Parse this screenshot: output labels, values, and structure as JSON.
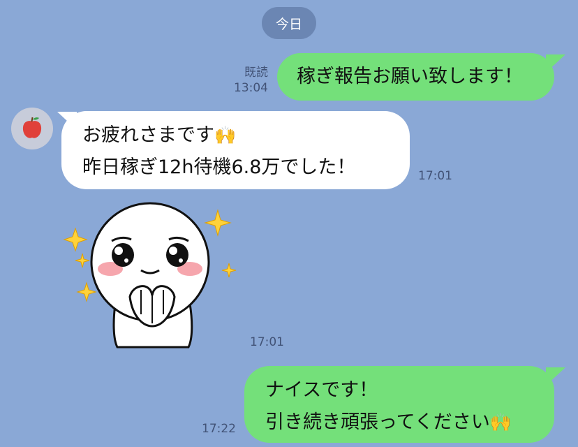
{
  "date_label": "今日",
  "messages": [
    {
      "text": "稼ぎ報告お願い致します！",
      "read_label": "既読",
      "time": "13:04"
    },
    {
      "line1": "お疲れさまです",
      "line1_emoji": "🙌",
      "line2": "昨日稼ぎ12h待機6.8万でした！",
      "time": "17:01"
    },
    {
      "sticker": "crying-moon-sticker",
      "time": "17:01"
    },
    {
      "line1": "ナイスです！",
      "line2": "引き続き頑張ってください",
      "line2_emoji": "🙌",
      "time": "17:22"
    }
  ],
  "icons": {
    "avatar": "apple-icon",
    "sparkle": "sparkle-icon"
  },
  "colors": {
    "background": "#8aa8d6",
    "outgoing_bubble": "#74e07a",
    "incoming_bubble": "#ffffff",
    "date_pill": "#6b86b3"
  }
}
